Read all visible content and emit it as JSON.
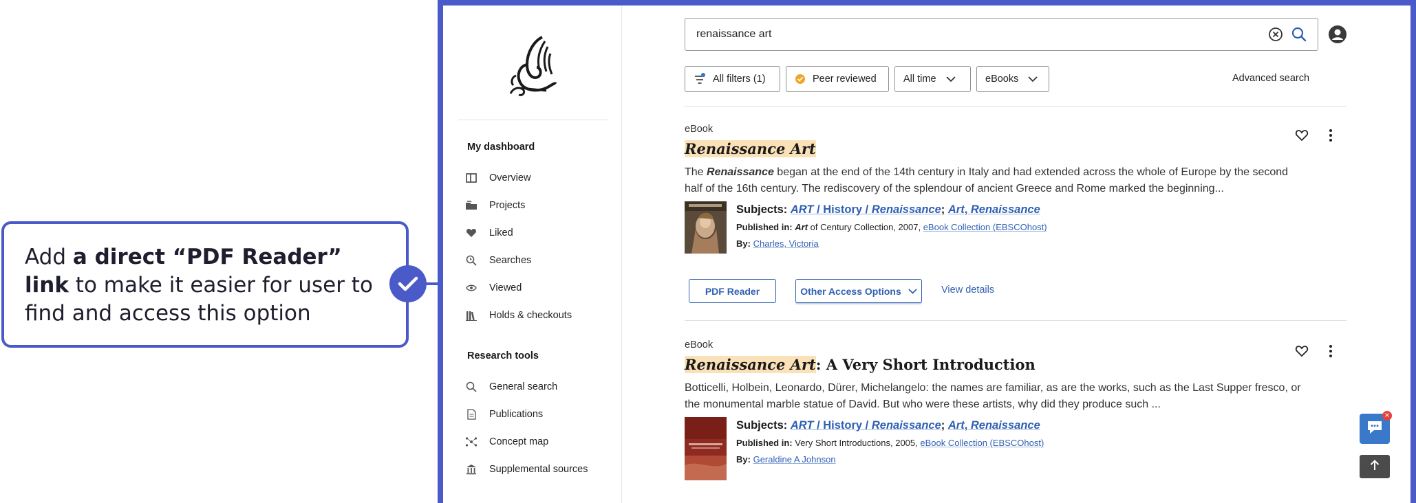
{
  "annotation": {
    "text_before": "Add ",
    "text_bold": "a direct “PDF Reader” link",
    "text_after": " to make it easier for user to find and access this option",
    "color": "#4a5ac9"
  },
  "sidebar": {
    "section1_title": "My dashboard",
    "dashboard_items": [
      {
        "label": "Overview",
        "icon": "layout-icon"
      },
      {
        "label": "Projects",
        "icon": "folder-icon"
      },
      {
        "label": "Liked",
        "icon": "heart-icon"
      },
      {
        "label": "Searches",
        "icon": "search-history-icon"
      },
      {
        "label": "Viewed",
        "icon": "eye-icon"
      },
      {
        "label": "Holds & checkouts",
        "icon": "books-icon"
      }
    ],
    "section2_title": "Research tools",
    "research_items": [
      {
        "label": "General search",
        "icon": "search-icon"
      },
      {
        "label": "Publications",
        "icon": "document-icon"
      },
      {
        "label": "Concept map",
        "icon": "concept-map-icon"
      },
      {
        "label": "Supplemental sources",
        "icon": "institution-icon"
      }
    ]
  },
  "search": {
    "value": "renaissance art",
    "clear_icon": "clear-circle-icon",
    "search_icon": "search-icon",
    "avatar_icon": "user-avatar-icon"
  },
  "filters": {
    "all_filters": "All filters (1)",
    "peer_reviewed": "Peer reviewed",
    "time": "All time",
    "type": "eBooks",
    "advanced": "Advanced search"
  },
  "results": [
    {
      "type": "eBook",
      "title_hl": "Renaissance Art",
      "title_rest": "",
      "desc_pre": "The ",
      "desc_em": "Renaissance",
      "desc_post": " began at the end of the 14th century in Italy and had extended across the whole of Europe by the second half of the 16th century. The rediscovery of the splendour of ancient Greece and Rome marked the beginning...",
      "subjects_label": "Subjects:",
      "subj_1a": "ART",
      "subj_1b": " / History / ",
      "subj_1c": "Renaissance",
      "subj_sep": ";",
      "subj_2a": "Art",
      "subj_2b": ", ",
      "subj_2c": "Renaissance",
      "published_label": "Published in:",
      "pub_em": "Art",
      "pub_rest": " of Century Collection, 2007,",
      "pub_link": "eBook Collection (EBSCOhost)",
      "by_label": "By:",
      "author": "Charles, Victoria"
    },
    {
      "type": "eBook",
      "title_hl": "Renaissance Art",
      "title_rest": ": A Very Short Introduction",
      "desc_pre": "Botticelli, Holbein, Leonardo, Dürer, Michelangelo: the names are familiar, as are the works, such as the Last Supper fresco, or the monumental marble statue of David. But who were these artists, why did they produce such ...",
      "subjects_label": "Subjects:",
      "subj_1a": "ART",
      "subj_1b": " / History / ",
      "subj_1c": "Renaissance",
      "subj_sep": ";",
      "subj_2a": "Art",
      "subj_2b": ", ",
      "subj_2c": "Renaissance",
      "published_label": "Published in:",
      "pub_rest": "Very Short Introductions, 2005,",
      "pub_link": "eBook Collection (EBSCOhost)",
      "by_label": "By:",
      "author": "Geraldine A Johnson"
    }
  ],
  "actions": {
    "pdf_reader": "PDF Reader",
    "other_access": "Other Access Options",
    "view_details": "View details"
  },
  "floating": {
    "chat_badge": "×"
  },
  "colors": {
    "accent": "#4a5ac9",
    "link": "#2f5fb3",
    "highlight": "#fbe1b8",
    "peer_badge": "#f0a52a"
  }
}
